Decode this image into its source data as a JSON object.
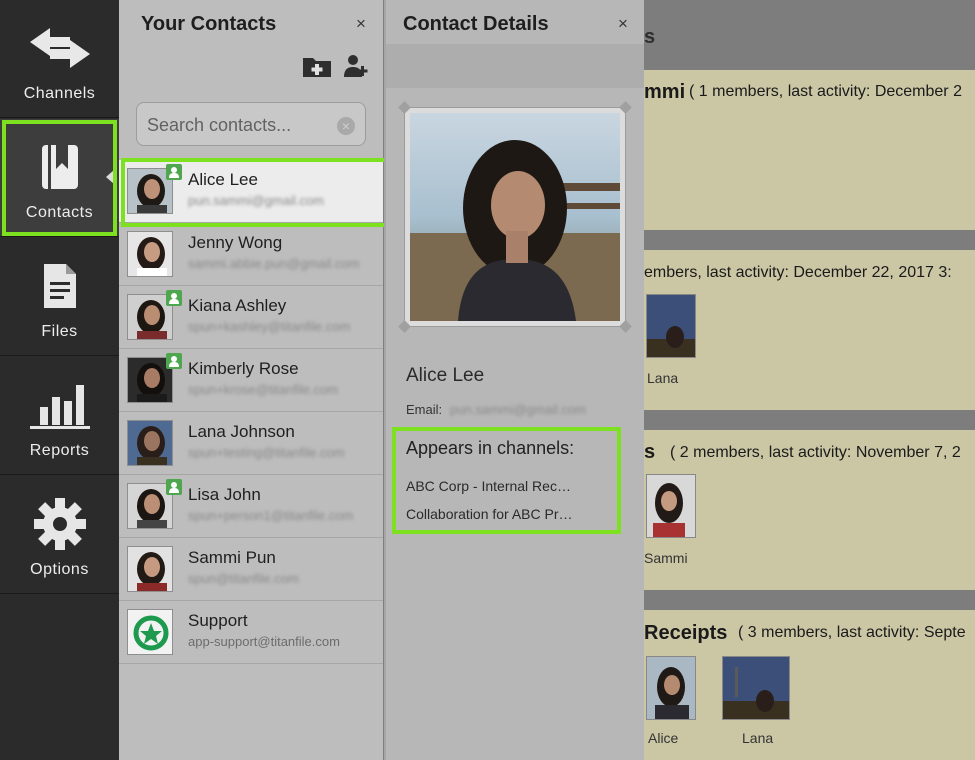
{
  "nav": {
    "items": [
      {
        "label": "Channels",
        "icon": "channels-icon"
      },
      {
        "label": "Contacts",
        "icon": "contacts-book-icon",
        "active": true
      },
      {
        "label": "Files",
        "icon": "file-icon"
      },
      {
        "label": "Reports",
        "icon": "bar-chart-icon"
      },
      {
        "label": "Options",
        "icon": "gear-icon"
      }
    ],
    "highlight_color": "#7ee11f"
  },
  "contacts_panel": {
    "title": "Your Contacts",
    "close": "×",
    "search": {
      "placeholder": "Search contacts...",
      "value": ""
    },
    "contacts": [
      {
        "name": "Alice Lee",
        "email": "pun.sammi@gmail.com",
        "email_blurred": true,
        "has_badge": true,
        "selected": true
      },
      {
        "name": "Jenny Wong",
        "email": "sammi.abbie.pun@gmail.com",
        "email_blurred": true,
        "has_badge": false
      },
      {
        "name": "Kiana Ashley",
        "email": "spun+kashley@titanfile.com",
        "email_blurred": true,
        "has_badge": true
      },
      {
        "name": "Kimberly Rose",
        "email": "spun+krose@titanfile.com",
        "email_blurred": true,
        "has_badge": true
      },
      {
        "name": "Lana Johnson",
        "email": "spun+testing@titanfile.com",
        "email_blurred": true,
        "has_badge": false
      },
      {
        "name": "Lisa John",
        "email": "spun+person1@titanfile.com",
        "email_blurred": true,
        "has_badge": true
      },
      {
        "name": "Sammi Pun",
        "email": "spun@titanfile.com",
        "email_blurred": true,
        "has_badge": false
      },
      {
        "name": "Support",
        "email": "app-support@titanfile.com",
        "email_blurred": false,
        "has_badge": false
      }
    ]
  },
  "details_panel": {
    "title": "Contact Details",
    "close": "×",
    "name": "Alice Lee",
    "email_label": "Email:",
    "email_value": "pun.sammi@gmail.com",
    "appears_title": "Appears in channels:",
    "channels": [
      "ABC Corp - Internal Rec…",
      "Collaboration for ABC Pr…"
    ]
  },
  "background_channels": {
    "header_fragment": "s",
    "cards": [
      {
        "title_fragment": "mmi",
        "meta": "( 1 members, last activity: December 2"
      },
      {
        "meta": "embers, last activity: December 22, 2017 3:",
        "members": [
          "Lana"
        ]
      },
      {
        "title_fragment": "s",
        "meta": "( 2 members, last activity: November 7, 2",
        "members": [
          "Sammi"
        ]
      },
      {
        "title_fragment": "Receipts",
        "meta": "( 3 members, last activity: Septe",
        "members": [
          "Alice",
          "Lana"
        ]
      }
    ]
  }
}
